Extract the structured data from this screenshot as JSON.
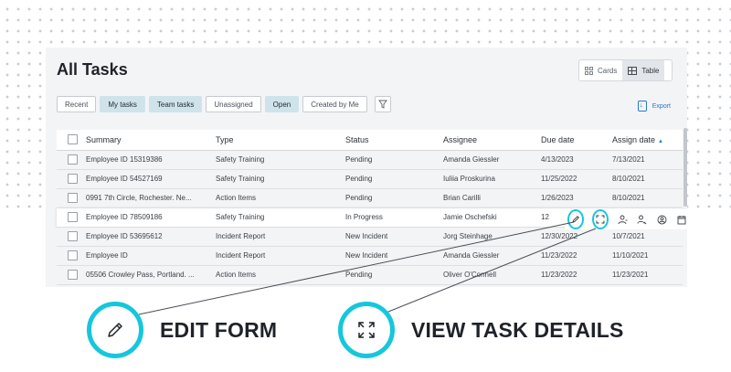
{
  "page": {
    "title": "All Tasks"
  },
  "view_toggle": {
    "cards_label": "Cards",
    "table_label": "Table",
    "active": "Table"
  },
  "filters": [
    {
      "label": "Recent",
      "active": false
    },
    {
      "label": "My tasks",
      "active": true
    },
    {
      "label": "Team tasks",
      "active": true
    },
    {
      "label": "Unassigned",
      "active": false
    },
    {
      "label": "Open",
      "active": true
    },
    {
      "label": "Created by Me",
      "active": false
    }
  ],
  "export_label": "Export",
  "table": {
    "columns": [
      "Summary",
      "Type",
      "Status",
      "Assignee",
      "Due date",
      "Assign date"
    ],
    "sort_icon": "▲",
    "rows": [
      {
        "summary": "Employee ID 15319386",
        "type": "Safety Training",
        "status": "Pending",
        "assignee": "Amanda Giessler",
        "due": "4/13/2023",
        "assign": "7/13/2021"
      },
      {
        "summary": "Employee ID 54527169",
        "type": "Safety Training",
        "status": "Pending",
        "assignee": "Iuliia Proskurina",
        "due": "11/25/2022",
        "assign": "8/10/2021"
      },
      {
        "summary": "0991 7th Circle, Rochester. Ne...",
        "type": "Action Items",
        "status": "Pending",
        "assignee": "Brian Carilli",
        "due": "1/26/2023",
        "assign": "8/10/2021"
      },
      {
        "summary": "Employee ID 78509186",
        "type": "Safety Training",
        "status": "In Progress",
        "assignee": "Jamie Oschefski",
        "due": "12",
        "assign": ""
      },
      {
        "summary": "Employee ID 53695612",
        "type": "Incident Report",
        "status": "New Incident",
        "assignee": "Jorg Steinhage",
        "due": "12/30/2022",
        "assign": "10/7/2021"
      },
      {
        "summary": "Employee ID",
        "type": "Incident Report",
        "status": "New Incident",
        "assignee": "Amanda Giessler",
        "due": "11/23/2022",
        "assign": "11/10/2021"
      },
      {
        "summary": "05506 Crowley Pass, Portland. ...",
        "type": "Action Items",
        "status": "Pending",
        "assignee": "Oliver O'Connell",
        "due": "11/23/2022",
        "assign": "11/23/2021"
      }
    ]
  },
  "callouts": {
    "edit": "EDIT FORM",
    "view": "VIEW TASK DETAILS"
  },
  "colors": {
    "accent": "#16c7dc",
    "link": "#2a79c7",
    "chip_active": "#cfe3ea"
  }
}
